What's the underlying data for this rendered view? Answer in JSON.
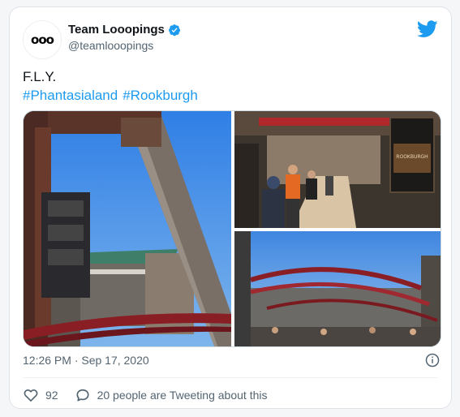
{
  "author": {
    "display_name": "Team Looopings",
    "handle": "@teamlooopings",
    "avatar_text": "ooo",
    "verified": true
  },
  "tweet": {
    "text_line": "F.L.Y.",
    "hashtags": [
      "#Phantasialand",
      "#Rookburgh"
    ],
    "timestamp": "12:26 PM · Sep 17, 2020"
  },
  "photos": [
    {
      "alt": "coaster-under-blue-sky"
    },
    {
      "alt": "queue-line-with-poster",
      "poster_text": "ROOKBURGH"
    },
    {
      "alt": "coaster-track-overview"
    }
  ],
  "engagement": {
    "likes": "92",
    "tweeting_label": "20 people are Tweeting about this"
  },
  "colors": {
    "accent": "#1d9bf0",
    "text": "#0f1419",
    "muted": "#536471"
  },
  "icons": [
    "verified-badge-icon",
    "twitter-bird-icon",
    "info-icon",
    "heart-icon",
    "comment-icon"
  ]
}
